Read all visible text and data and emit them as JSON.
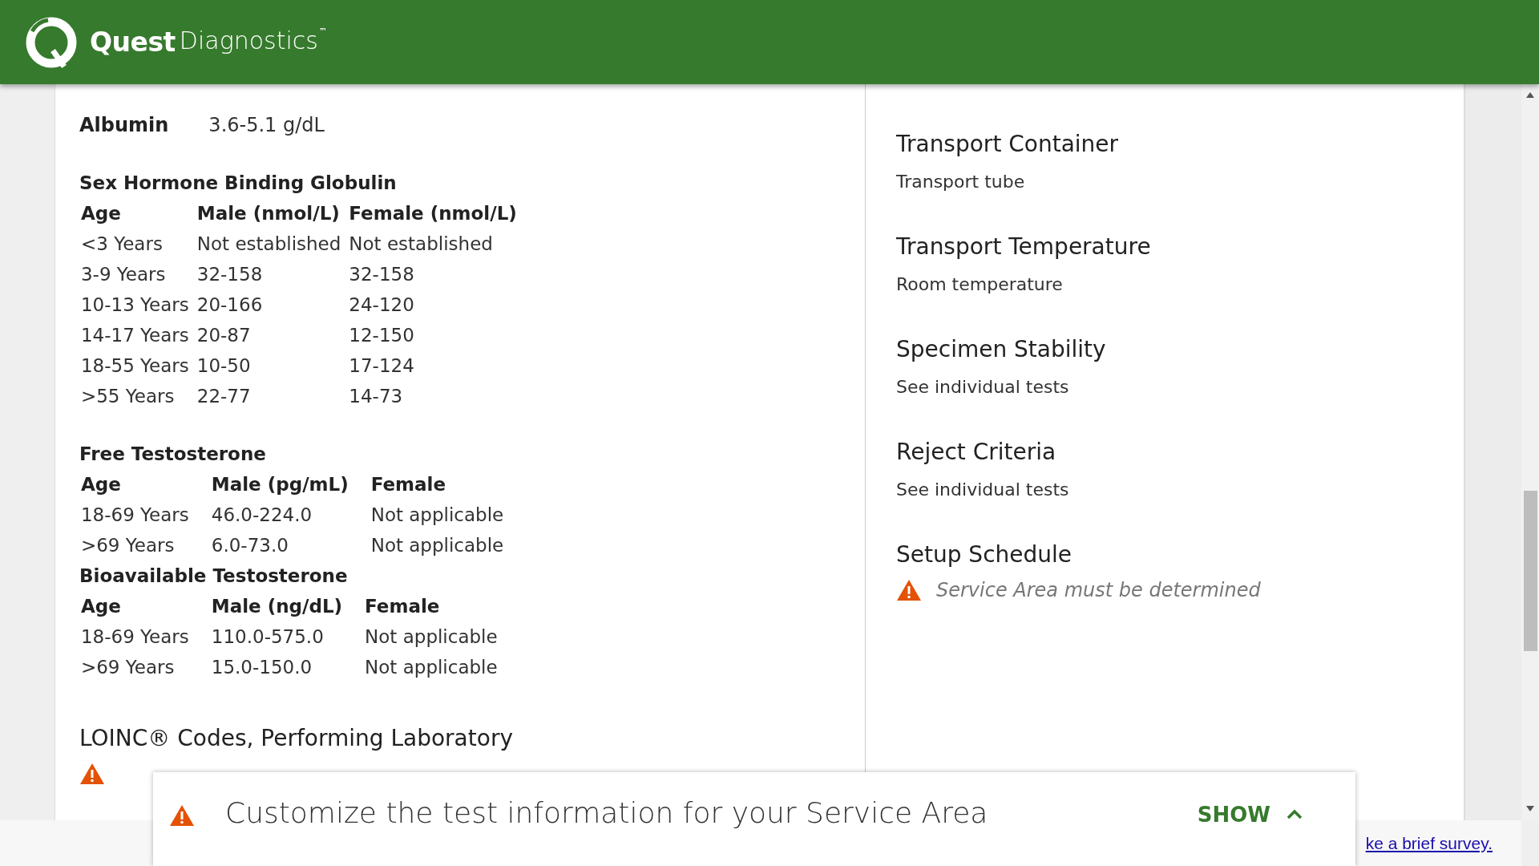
{
  "header": {
    "brand_bold": "Quest",
    "brand_light": "Diagnostics",
    "trademark": "™"
  },
  "left": {
    "albumin": {
      "label": "Albumin",
      "value": "3.6-5.1 g/dL"
    },
    "tables": [
      {
        "title": "Sex Hormone Binding Globulin",
        "columns": [
          "Age",
          "Male (nmol/L)",
          "Female (nmol/L)"
        ],
        "rows": [
          [
            "<3 Years",
            "Not established",
            "Not established"
          ],
          [
            "3-9 Years",
            "32-158",
            "32-158"
          ],
          [
            "10-13 Years",
            "20-166",
            "24-120"
          ],
          [
            "14-17 Years",
            "20-87",
            "12-150"
          ],
          [
            "18-55 Years",
            "10-50",
            "17-124"
          ],
          [
            ">55 Years",
            "22-77",
            "14-73"
          ]
        ]
      },
      {
        "title": "Free Testosterone",
        "columns": [
          "Age",
          "Male (pg/mL)",
          "Female"
        ],
        "rows": [
          [
            "18-69 Years",
            "46.0-224.0",
            "Not applicable"
          ],
          [
            ">69 Years",
            "6.0-73.0",
            "Not applicable"
          ]
        ]
      },
      {
        "title": "Bioavailable Testosterone",
        "columns": [
          "Age",
          "Male (ng/dL)",
          "Female"
        ],
        "rows": [
          [
            "18-69 Years",
            "110.0-575.0",
            "Not applicable"
          ],
          [
            ">69 Years",
            "15.0-150.0",
            "Not applicable"
          ]
        ]
      }
    ],
    "loinc": {
      "heading": "LOINC® Codes, Performing Laboratory"
    }
  },
  "right": {
    "sections": [
      {
        "kind": "text",
        "heading": "Transport Container",
        "text": "Transport tube"
      },
      {
        "kind": "text",
        "heading": "Transport Temperature",
        "text": "Room temperature"
      },
      {
        "kind": "text",
        "heading": "Specimen Stability",
        "text": "See individual tests"
      },
      {
        "kind": "text",
        "heading": "Reject Criteria",
        "text": "See individual tests"
      },
      {
        "kind": "warning",
        "heading": "Setup Schedule",
        "text": "Service Area must be determined"
      }
    ]
  },
  "banner": {
    "text": "Customize the test information for your Service Area",
    "button": "SHOW",
    "expanded": false
  },
  "footer": {
    "link": "ke a brief survey."
  }
}
